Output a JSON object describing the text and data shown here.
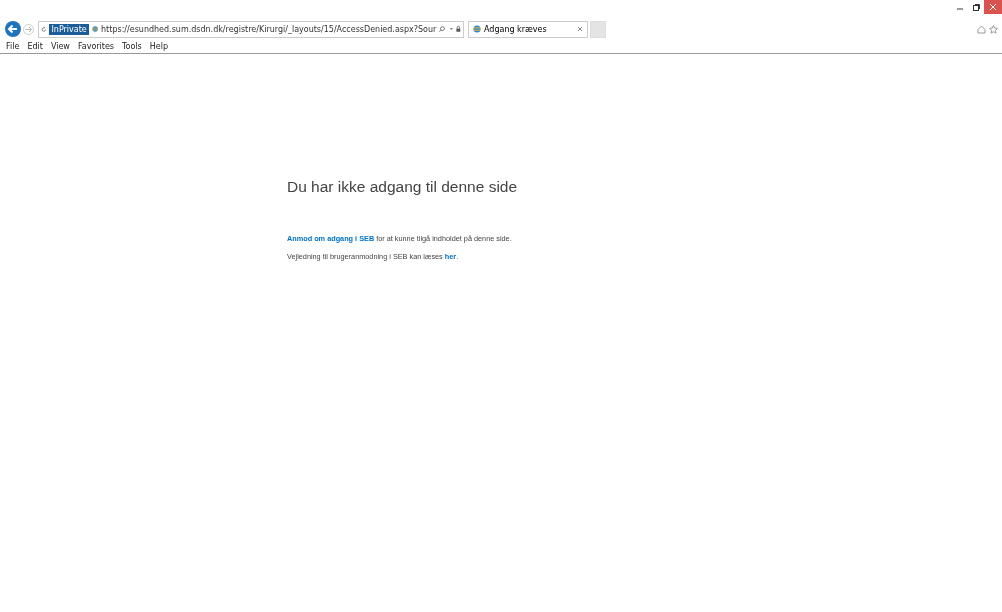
{
  "browser": {
    "private_badge": "InPrivate",
    "address": "https://esundhed.sum.dsdn.dk/registre/Kirurgi/_layouts/15/AccessDenied.aspx?Sour",
    "tabs": [
      {
        "title": "Adgang kræves",
        "selected": true
      }
    ],
    "menu": [
      "File",
      "Edit",
      "View",
      "Favorites",
      "Tools",
      "Help"
    ]
  },
  "page": {
    "heading": "Du har ikke adgang til denne side",
    "paragraphs": [
      [
        {
          "kind": "link",
          "text": "Anmod om adgang i SEB"
        },
        {
          "kind": "text",
          "text": " for at kunne tilgå indholdet på denne side."
        }
      ],
      [
        {
          "kind": "text",
          "text": "Vejledning til brugeranmodning i SEB kan læses "
        },
        {
          "kind": "link",
          "text": "her"
        },
        {
          "kind": "text",
          "text": "."
        }
      ]
    ]
  }
}
